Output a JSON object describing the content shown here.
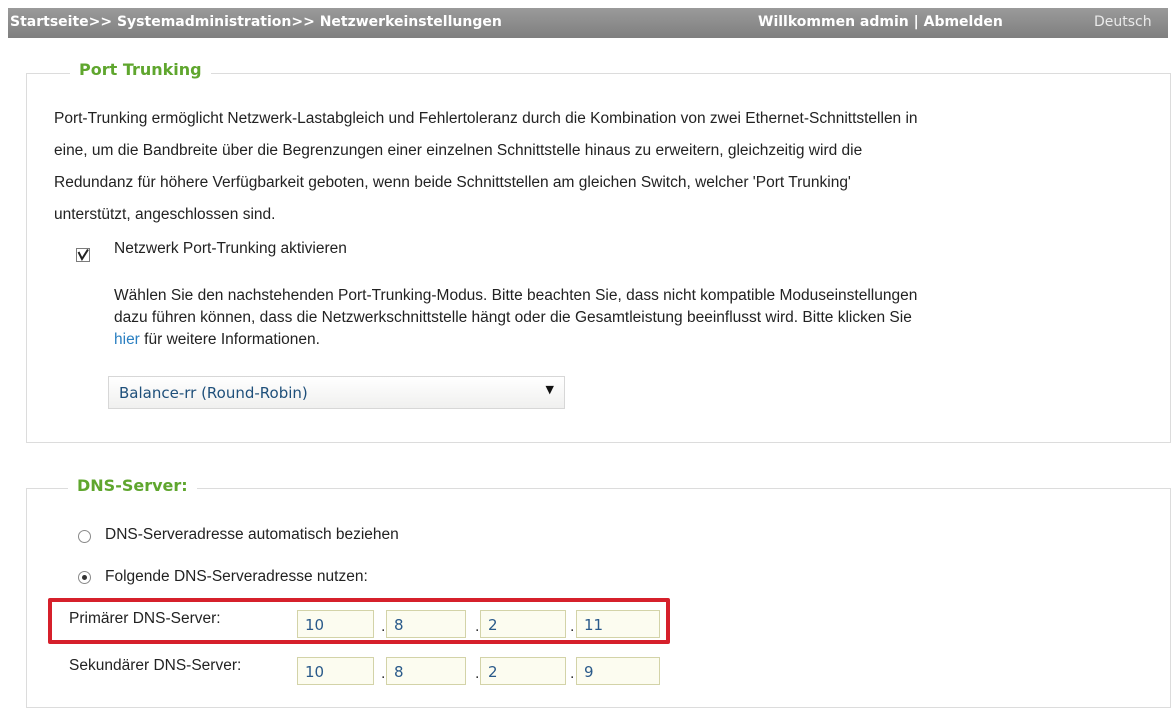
{
  "topbar": {
    "breadcrumb": "Startseite>> Systemadministration>> Netzwerkeinstellungen",
    "welcome_text": "Willkommen admin",
    "separator": "|",
    "logout_label": "Abmelden",
    "language": "Deutsch"
  },
  "port_trunking": {
    "legend": "Port Trunking",
    "description_lines": [
      "Port-Trunking ermöglicht Netzwerk-Lastabgleich und Fehlertoleranz durch die Kombination von zwei Ethernet-Schnittstellen in",
      "eine, um die Bandbreite über die Begrenzungen einer einzelnen Schnittstelle hinaus zu erweitern, gleichzeitig wird die",
      "Redundanz für höhere Verfügbarkeit geboten, wenn beide Schnittstellen am gleichen Switch, welcher 'Port Trunking'",
      "unterstützt, angeschlossen sind."
    ],
    "enable_label": "Netzwerk Port-Trunking aktivieren",
    "enable_checked": true,
    "mode_lines": [
      "Wählen Sie den nachstehenden Port-Trunking-Modus. Bitte beachten Sie, dass nicht kompatible Moduseinstellungen",
      "dazu führen können, dass die Netzwerkschnittstelle hängt oder die Gesamtleistung beeinflusst wird. Bitte klicken Sie"
    ],
    "mode_link": "hier",
    "mode_tail": "für weitere Informationen.",
    "mode_selected": "Balance-rr (Round-Robin)"
  },
  "dns": {
    "legend": "DNS-Server:",
    "auto_label": "DNS-Serveradresse automatisch beziehen",
    "manual_label": "Folgende DNS-Serveradresse nutzen:",
    "primary_label": "Primärer DNS-Server:",
    "primary": [
      "10",
      "8",
      "2",
      "11"
    ],
    "secondary_label": "Sekundärer DNS-Server:",
    "secondary": [
      "10",
      "8",
      "2",
      "9"
    ],
    "ip_separator": "."
  },
  "colors": {
    "legend_green": "#5fa62e",
    "highlight_red": "#d6202b",
    "link_blue": "#2a7fc1"
  },
  "icons": {
    "checkbox_mark": "check-icon",
    "dropdown_arrow": "caret-down-icon"
  }
}
